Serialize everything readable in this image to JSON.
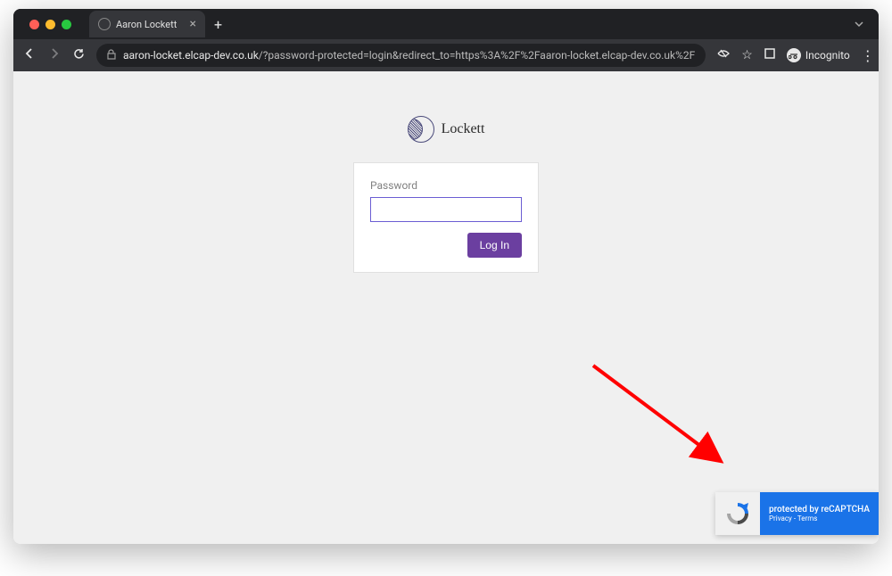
{
  "browser": {
    "tab_title": "Aaron Lockett",
    "url_domain": "aaron-locket.elcap-dev.co.uk",
    "url_path": "/?password-protected=login&redirect_to=https%3A%2F%2Faaron-locket.elcap-dev.co.uk%2F",
    "incognito_label": "Incognito"
  },
  "page": {
    "brand_name": "Lockett",
    "form": {
      "password_label": "Password",
      "password_value": "",
      "submit_label": "Log In"
    }
  },
  "recaptcha": {
    "title": "protected by reCAPTCHA",
    "privacy_label": "Privacy",
    "separator": " - ",
    "terms_label": "Terms"
  }
}
